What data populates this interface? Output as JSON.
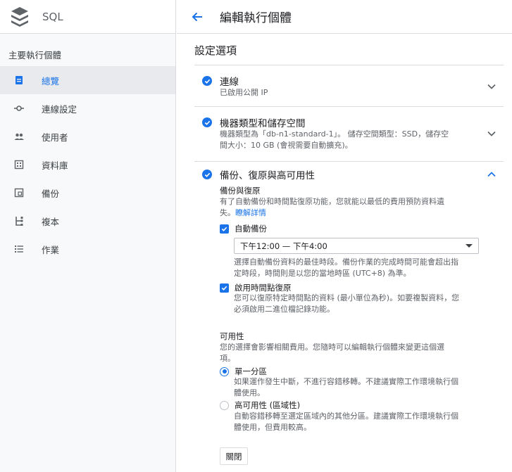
{
  "app": {
    "product_name": "SQL"
  },
  "sidebar": {
    "section_title": "主要執行個體",
    "items": [
      {
        "label": "總覽",
        "icon": "overview-icon",
        "active": true
      },
      {
        "label": "連線設定",
        "icon": "connection-icon",
        "active": false
      },
      {
        "label": "使用者",
        "icon": "users-icon",
        "active": false
      },
      {
        "label": "資料庫",
        "icon": "database-icon",
        "active": false
      },
      {
        "label": "備份",
        "icon": "backup-icon",
        "active": false
      },
      {
        "label": "複本",
        "icon": "replica-icon",
        "active": false
      },
      {
        "label": "作業",
        "icon": "operations-icon",
        "active": false
      }
    ]
  },
  "header": {
    "title": "編輯執行個體"
  },
  "main": {
    "section_title": "設定選項",
    "panels": [
      {
        "title": "連線",
        "subtitle": "已啟用公開 IP",
        "expanded": false
      },
      {
        "title": "機器類型和儲存空間",
        "subtitle_line1": "機器類型為「db-n1-standard-1」。 儲存空間類型：SSD，儲存空",
        "subtitle_line2": "間大小：10 GB (會視需要自動擴充)。",
        "expanded": false
      },
      {
        "title": "備份、復原與高可用性",
        "expanded": true
      }
    ],
    "backup": {
      "heading": "備份與復原",
      "desc_line1": "有了自動備份和時間點復原功能，您就能以最低的費用預防資料遺",
      "desc_line2_prefix": "失。",
      "learn_more": "瞭解詳情",
      "auto_backup_label": "自動備份",
      "auto_backup_checked": true,
      "window_value": "下午12:00 — 下午4:00",
      "window_help_line1": "選擇自動備份資料的最佳時段。備份作業的完成時間可能會超出指",
      "window_help_line2": "定時段，時間則是以您的當地時區 (UTC+8) 為準。",
      "pitr_label": "啟用時間點復原",
      "pitr_checked": true,
      "pitr_help_line1": "您可以復原特定時間點的資料 (最小單位為秒)。如要複製資料，您",
      "pitr_help_line2": "必須啟用二進位檔記錄功能。"
    },
    "availability": {
      "heading": "可用性",
      "desc_line1": "您的選擇會影響相關費用。您隨時可以編輯執行個體來變更這個選",
      "desc_line2": "項。",
      "options": [
        {
          "label": "單一分區",
          "help_line1": "如果運作發生中斷，不進行容錯移轉。不建議實際工作環境執行個",
          "help_line2": "體使用。",
          "selected": true
        },
        {
          "label": "高可用性 (區域性)",
          "help_line1": "自動容錯移轉至選定區域內的其他分區。建議實際工作環境執行個",
          "help_line2": "體使用，但費用較高。",
          "selected": false
        }
      ]
    },
    "close_label": "關閉"
  },
  "colors": {
    "accent": "#1a73e8",
    "sidebar_bg": "#f8f9fa",
    "active_bg": "#e8eaed",
    "text": "#202124",
    "muted": "#5f6368"
  }
}
